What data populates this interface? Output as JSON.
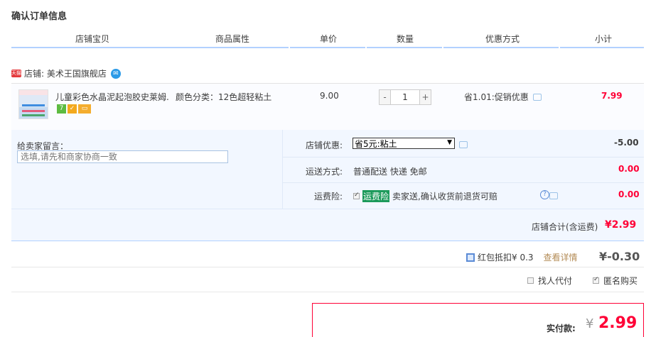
{
  "page_title": "确认订单信息",
  "columns": [
    "店铺宝贝",
    "商品属性",
    "单价",
    "数量",
    "优惠方式",
    "小计"
  ],
  "shop": {
    "badge": "天猫",
    "label": "店铺: 美术王国旗舰店",
    "ww_glyph": "✉"
  },
  "item": {
    "name": "儿童彩色水晶泥起泡胶史莱姆...",
    "service_icons": [
      "seven-day-return-icon",
      "guarantee-icon",
      "card-payment-icon"
    ],
    "service_glyphs": [
      "7",
      "✓",
      "▭"
    ],
    "attr": "颜色分类：12色超轻粘土",
    "price": "9.00",
    "qty": "1",
    "minus": "-",
    "plus": "+",
    "discount": "省1.01:促销优惠",
    "subtotal": "7.99"
  },
  "panel": {
    "memo_label": "给卖家留言：",
    "memo_placeholder": "选填,请先和商家协商一致",
    "coupon_label": "店铺优惠:",
    "coupon_selected": "省5元:粘土",
    "coupon_value": "-5.00",
    "shipping_label": "运送方式:",
    "shipping_value": "普通配送 快递 免邮",
    "shipping_fee": "0.00",
    "insure_label": "运费险:",
    "insure_tag": "运费险",
    "insure_text": "卖家送,确认收货前退货可赔",
    "insure_fee": "0.00",
    "shop_total_label": "店铺合计(含运费)",
    "shop_total_value": "¥2.99"
  },
  "hongbao": {
    "label": "红包抵扣¥ 0.3",
    "link": "查看详情",
    "value": "¥-0.30"
  },
  "options": {
    "proxy": "找人代付",
    "anonymous": "匿名购买"
  },
  "pay": {
    "label": "实付款:",
    "yen": "¥",
    "value": "2.99"
  },
  "colors": {
    "accent_red": "#ff0036",
    "panel_bg": "#f2f7ff",
    "rule_blue": "#b2d1ff"
  }
}
